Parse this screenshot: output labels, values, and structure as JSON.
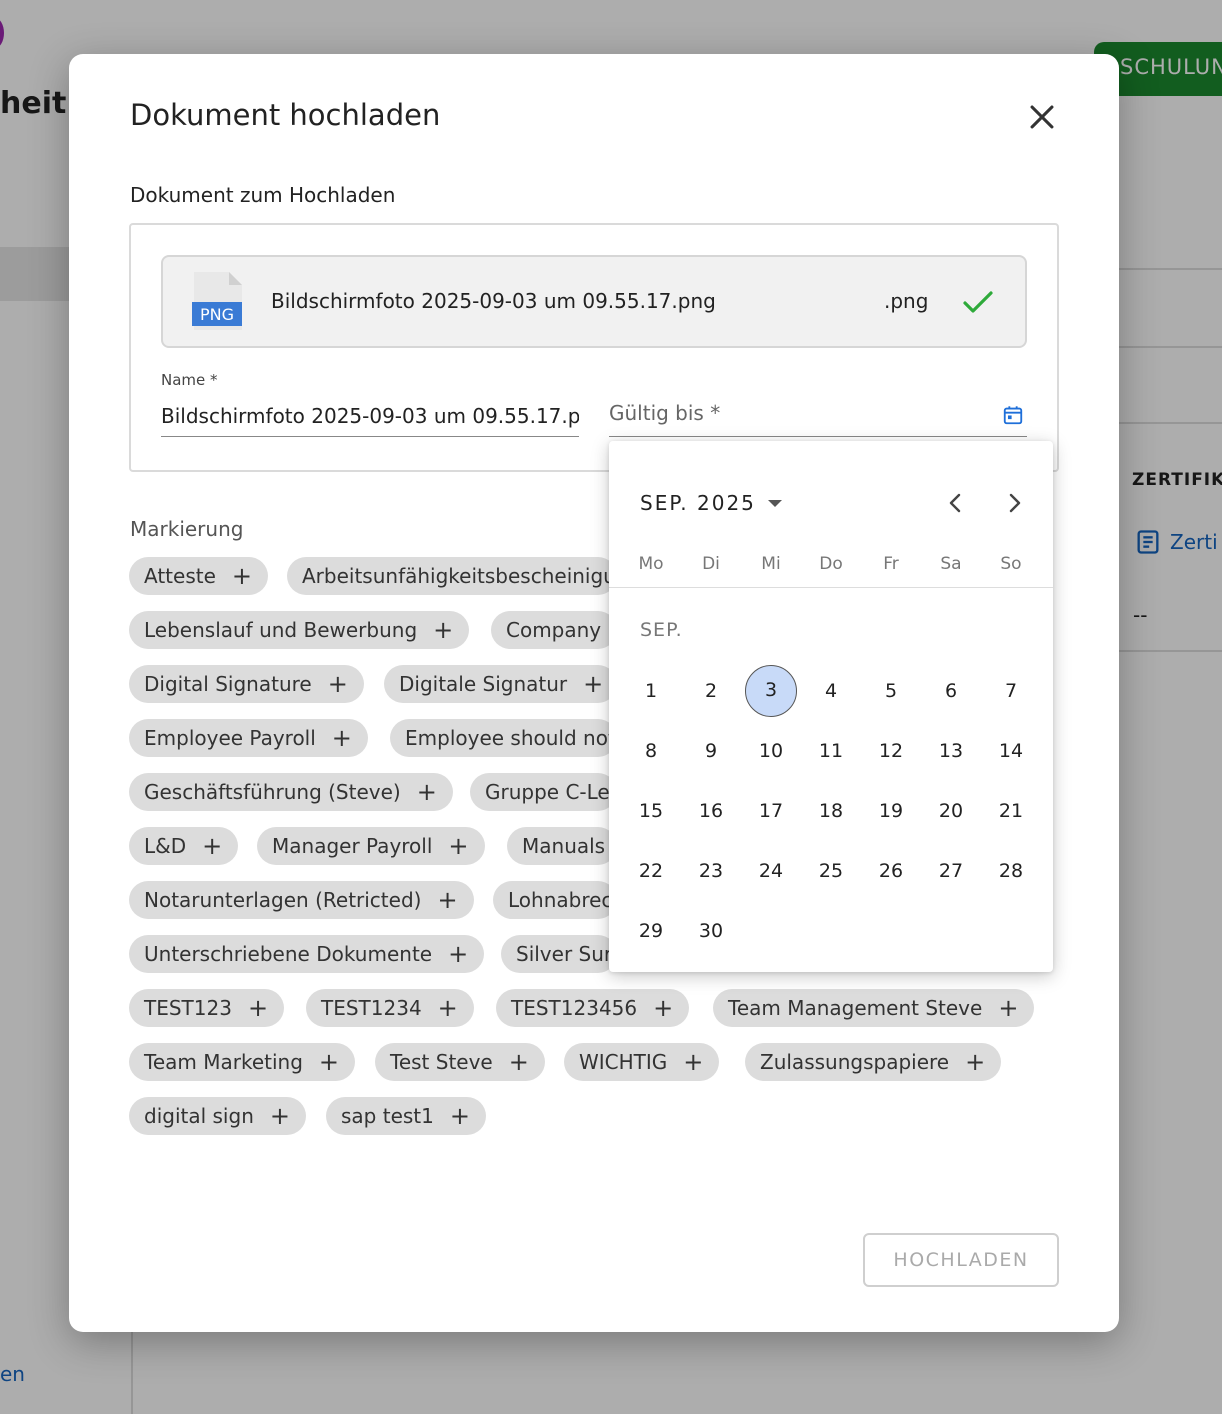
{
  "background": {
    "header_partial": "heit",
    "button_partial": "SCHULUN",
    "column_header_partial": "ZERTIFIKA",
    "link_partial": "Zerti",
    "cell_value": "--",
    "sidebar_link_partial": "en"
  },
  "modal": {
    "title": "Dokument hochladen",
    "section_label": "Dokument zum Hochladen",
    "file": {
      "type_label": "PNG",
      "name": "Bildschirmfoto 2025-09-03 um 09.55.17.png",
      "extension": ".png"
    },
    "name_field": {
      "label": "Name *",
      "value": "Bildschirmfoto 2025-09-03 um 09.55.17.png"
    },
    "date_field": {
      "placeholder": "Gültig bis *"
    },
    "markierung_label": "Markierung",
    "chips": [
      "Atteste",
      "Arbeitsunfähigkeitsbescheinigung",
      "Lebenslauf und Bewerbung",
      "Company",
      "Digital Signature",
      "Digitale Signatur",
      "Employee Payroll",
      "Employee should not",
      "Geschäftsführung (Steve)",
      "Gruppe C-Level",
      "L&D",
      "Manager Payroll",
      "Manuals",
      "Notarunterlagen (Retricted)",
      "Lohnabrechnung",
      "Unterschriebene Dokumente",
      "Silver Surfer",
      "TEST123",
      "TEST1234",
      "TEST123456",
      "Team Management Steve",
      "Team Marketing",
      "Test Steve",
      "WICHTIG",
      "Zulassungspapiere",
      "digital sign",
      "sap test1"
    ],
    "submit_label": "HOCHLADEN"
  },
  "datepicker": {
    "month_year": "SEP. 2025",
    "weekdays": [
      "Mo",
      "Di",
      "Mi",
      "Do",
      "Fr",
      "Sa",
      "So"
    ],
    "month_label": "SEP.",
    "days": [
      "1",
      "2",
      "3",
      "4",
      "5",
      "6",
      "7",
      "8",
      "9",
      "10",
      "11",
      "12",
      "13",
      "14",
      "15",
      "16",
      "17",
      "18",
      "19",
      "20",
      "21",
      "22",
      "23",
      "24",
      "25",
      "26",
      "27",
      "28",
      "29",
      "30"
    ],
    "selected_day": "3",
    "first_weekday_index": 0
  },
  "colors": {
    "accent_blue": "#1565c0",
    "check_green": "#2eaa3a",
    "selected_day_bg": "#c8daf8",
    "brand_green": "#1b8a2e"
  }
}
